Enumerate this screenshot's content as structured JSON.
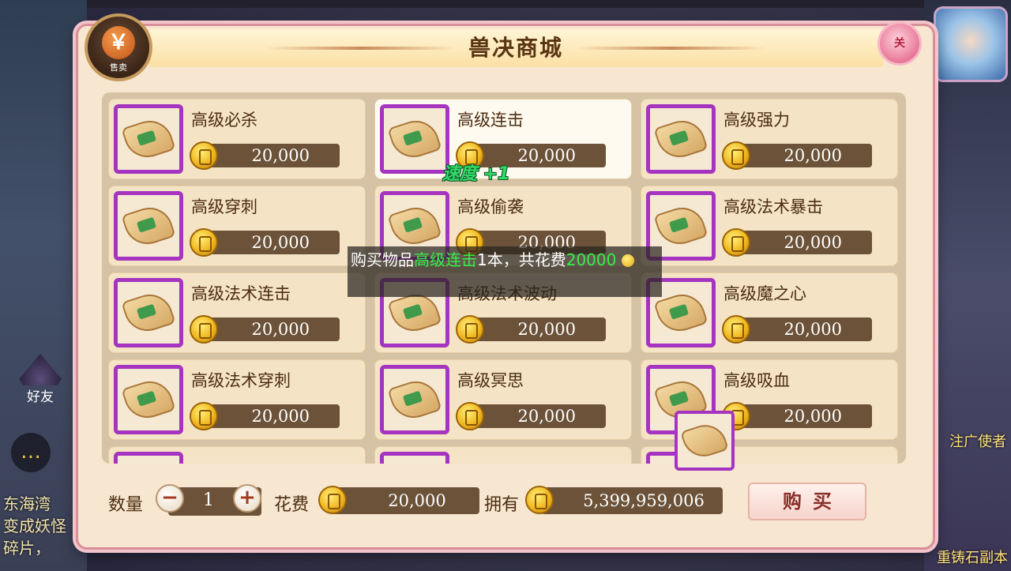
{
  "shop": {
    "title": "兽决商城",
    "sell_label": "售卖",
    "sell_glyph": "￥",
    "close_label": "关"
  },
  "items": [
    {
      "name": "高级必杀",
      "price": "20,000"
    },
    {
      "name": "高级连击",
      "price": "20,000"
    },
    {
      "name": "高级强力",
      "price": "20,000"
    },
    {
      "name": "高级穿刺",
      "price": "20,000"
    },
    {
      "name": "高级偷袭",
      "price": "20,000"
    },
    {
      "name": "高级法术暴击",
      "price": "20,000"
    },
    {
      "name": "高级法术连击",
      "price": "20,000"
    },
    {
      "name": "高级法术波动",
      "price": "20,000"
    },
    {
      "name": "高级魔之心",
      "price": "20,000"
    },
    {
      "name": "高级法术穿刺",
      "price": "20,000"
    },
    {
      "name": "高级冥思",
      "price": "20,000"
    },
    {
      "name": "高级吸血",
      "price": "20,000"
    }
  ],
  "selected_index": 1,
  "floating": {
    "speed_text": "速度 +1"
  },
  "toast": {
    "prefix": "购买物品",
    "item": "高级连击",
    "mid": "1本，共花费",
    "amount": "20000"
  },
  "bottom": {
    "qty_label": "数量",
    "qty_value": "1",
    "minus": "−",
    "plus": "+",
    "cost_label": "花费",
    "cost_value": "20,000",
    "own_label": "拥有",
    "own_value": "5,399,959,006",
    "buy_label": "购买"
  },
  "background": {
    "friend_label": "好友",
    "chat_lines": [
      "东海湾",
      "变成妖怪",
      "碎片，"
    ],
    "right_lines": [
      "注广使者"
    ],
    "bottom_right": "重铸石副本"
  },
  "colors": {
    "rarity_border": "#a534c0",
    "toast_highlight": "#36f04a",
    "speed_text": "#34d86a"
  }
}
